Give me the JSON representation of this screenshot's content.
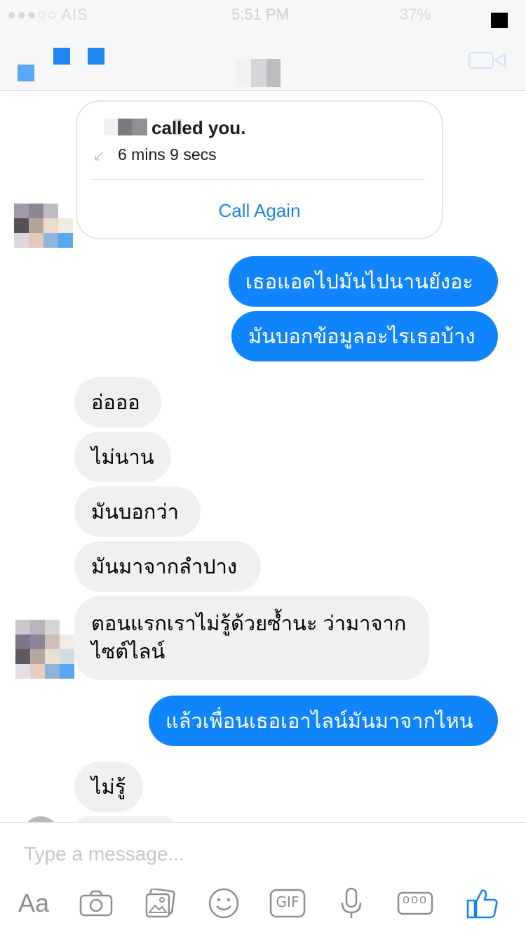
{
  "statusbar": {
    "carrier": "●●●○○ AIS",
    "time": "5:51 PM",
    "battery": "37%"
  },
  "call_card": {
    "title": "called you.",
    "duration": "6 mins 9 secs",
    "action": "Call Again"
  },
  "messages": [
    {
      "from": "me",
      "text": "เธอแอดไปมันไปนานยังอะ"
    },
    {
      "from": "me",
      "text": "มันบอกข้อมูลอะไรเธอบ้าง"
    },
    {
      "from": "them",
      "text": "อ่อออ"
    },
    {
      "from": "them",
      "text": "ไม่นาน"
    },
    {
      "from": "them",
      "text": "มันบอกว่า"
    },
    {
      "from": "them",
      "text": "มันมาจากลำปาง"
    },
    {
      "from": "them",
      "line1": "ตอนแรกเราไม่รู้ด้วยซ้ำนะ ว่ามาจาก",
      "line2": "ไซต์ไลน์"
    },
    {
      "from": "me",
      "text": "แล้วเพื่อนเธอเอาไลน์มันมาจากไหน"
    },
    {
      "from": "them",
      "text": "ไม่รู้"
    }
  ],
  "composer": {
    "placeholder": "Type a message...",
    "text_tool": "Aa",
    "gif_label": "GIF",
    "more_label": "ooo"
  },
  "colors": {
    "accent": "#0f84fb",
    "incoming": "#f0f0f1",
    "link": "#1f86e6"
  },
  "icons": [
    "camera-icon",
    "photo-gallery-icon",
    "emoji-icon",
    "gif-icon",
    "microphone-icon",
    "more-icon",
    "thumbs-up-icon",
    "video-call-icon"
  ]
}
